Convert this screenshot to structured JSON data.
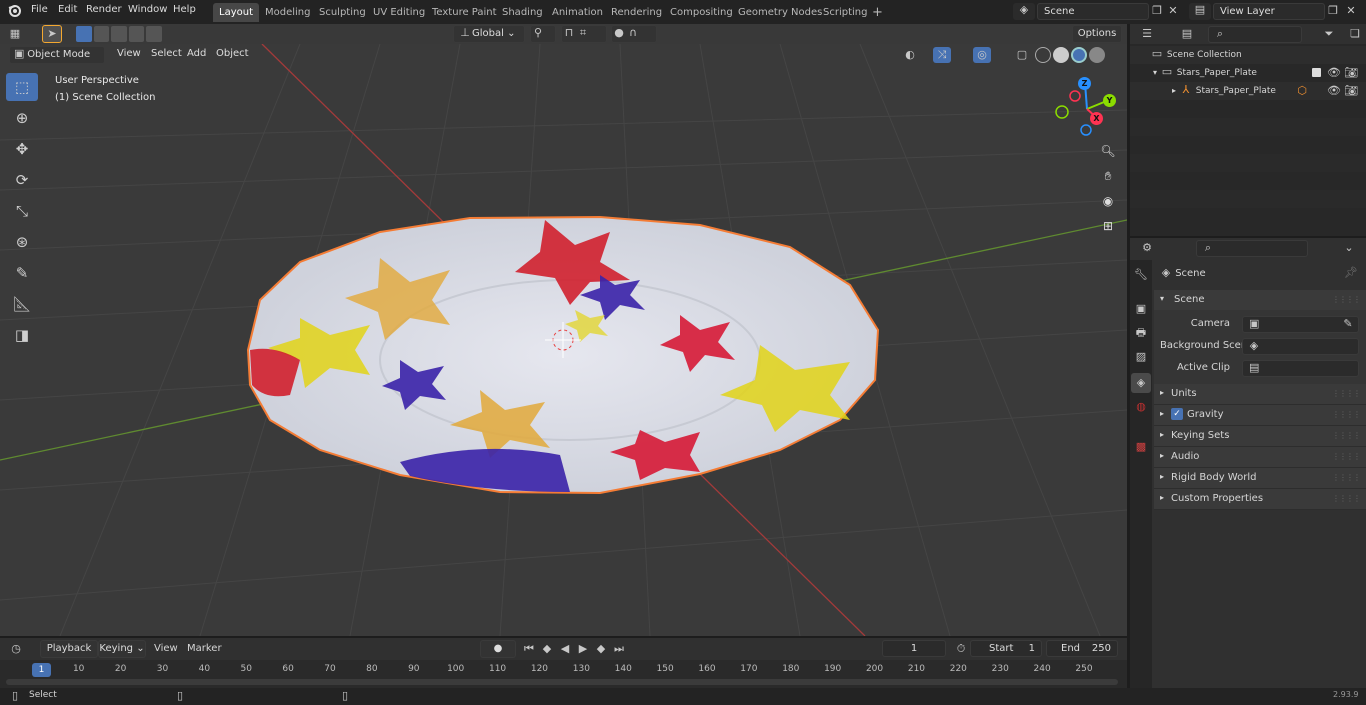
{
  "menu": {
    "file": "File",
    "edit": "Edit",
    "render": "Render",
    "window": "Window",
    "help": "Help"
  },
  "workspaces": [
    "Layout",
    "Modeling",
    "Sculpting",
    "UV Editing",
    "Texture Paint",
    "Shading",
    "Animation",
    "Rendering",
    "Compositing",
    "Geometry Nodes",
    "Scripting"
  ],
  "scene_name": "Scene",
  "view_layer": "View Layer",
  "viewport": {
    "orientation": "Global",
    "options_label": "Options",
    "mode": "Object Mode",
    "view_label": "View",
    "select_label": "Select",
    "add_label": "Add",
    "object_label": "Object",
    "perspective": "User Perspective",
    "collection": "(1) Scene Collection",
    "gizmo": {
      "z": "Z",
      "y": "Y",
      "x": "X"
    }
  },
  "outliner": {
    "scene_collection": "Scene Collection",
    "collection": "Stars_Paper_Plate",
    "object": "Stars_Paper_Plate"
  },
  "properties": {
    "context": "Scene",
    "panel": "Scene",
    "camera_label": "Camera",
    "background_label": "Background Scene",
    "clip_label": "Active Clip",
    "sections": [
      "Units",
      "Gravity",
      "Keying Sets",
      "Audio",
      "Rigid Body World",
      "Custom Properties"
    ]
  },
  "timeline": {
    "playback": "Playback",
    "keying": "Keying",
    "view": "View",
    "marker": "Marker",
    "current_frame": "1",
    "start_label": "Start",
    "start": "1",
    "end_label": "End",
    "end": "250",
    "ticks": [
      "1",
      "10",
      "20",
      "30",
      "40",
      "50",
      "60",
      "70",
      "80",
      "90",
      "100",
      "110",
      "120",
      "130",
      "140",
      "150",
      "160",
      "170",
      "180",
      "190",
      "200",
      "210",
      "220",
      "230",
      "240",
      "250"
    ]
  },
  "status": {
    "select": "Select",
    "version": "2.93.9"
  },
  "colors": {
    "accent": "#4772b3",
    "x_axis": "#ff3352",
    "y_axis": "#8bdc00",
    "z_axis": "#2890ff",
    "selection": "#f47c35"
  }
}
